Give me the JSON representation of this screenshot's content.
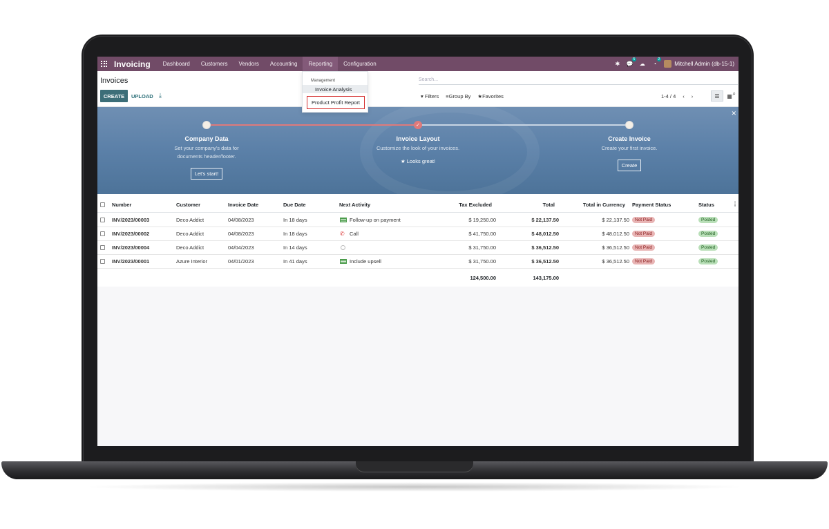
{
  "navbar": {
    "brand": "Invoicing",
    "menu": [
      "Dashboard",
      "Customers",
      "Vendors",
      "Accounting",
      "Reporting",
      "Configuration"
    ],
    "active_menu": "Reporting",
    "messages_badge": "5",
    "activities_badge": "2",
    "user": "Mitchell Admin (db-15-1)"
  },
  "control_panel": {
    "title": "Invoices",
    "create_label": "CREATE",
    "upload_label": "UPLOAD",
    "search_placeholder": "Search...",
    "filters_label": "Filters",
    "groupby_label": "Group By",
    "favorites_label": "Favorites",
    "pager": "1-4 / 4"
  },
  "dropdown": {
    "header": "Management",
    "items": [
      "Invoice Analysis",
      "Product Profit Report"
    ]
  },
  "banner": {
    "steps": [
      {
        "title": "Company Data",
        "desc1": "Set your company's data for",
        "desc2": "documents header/footer.",
        "button": "Let's start!"
      },
      {
        "title": "Invoice Layout",
        "desc1": "Customize the look of your invoices.",
        "status": "★ Looks great!"
      },
      {
        "title": "Create Invoice",
        "desc1": "Create your first invoice.",
        "button": "Create"
      }
    ]
  },
  "table": {
    "columns": [
      "Number",
      "Customer",
      "Invoice Date",
      "Due Date",
      "Next Activity",
      "Tax Excluded",
      "Total",
      "Total in Currency",
      "Payment Status",
      "Status"
    ],
    "rows": [
      {
        "number": "INV/2023/00003",
        "customer": "Deco Addict",
        "invoice_date": "04/08/2023",
        "due_date": "In 18 days",
        "activity": "Follow-up on payment",
        "activity_icon": "todo-icon",
        "tax_excluded": "$ 19,250.00",
        "total": "$ 22,137.50",
        "total_currency": "$ 22,137.50",
        "payment_status": "Not Paid",
        "status": "Posted"
      },
      {
        "number": "INV/2023/00002",
        "customer": "Deco Addict",
        "invoice_date": "04/08/2023",
        "due_date": "In 18 days",
        "activity": "Call",
        "activity_icon": "phone-icon",
        "tax_excluded": "$ 41,750.00",
        "total": "$ 48,012.50",
        "total_currency": "$ 48,012.50",
        "payment_status": "Not Paid",
        "status": "Posted"
      },
      {
        "number": "INV/2023/00004",
        "customer": "Deco Addict",
        "invoice_date": "04/04/2023",
        "due_date": "In 14 days",
        "activity": "",
        "activity_icon": "clock-icon",
        "tax_excluded": "$ 31,750.00",
        "total": "$ 36,512.50",
        "total_currency": "$ 36,512.50",
        "payment_status": "Not Paid",
        "status": "Posted"
      },
      {
        "number": "INV/2023/00001",
        "customer": "Azure Interior",
        "invoice_date": "04/01/2023",
        "due_date": "In 41 days",
        "activity": "Include upsell",
        "activity_icon": "todo-icon",
        "tax_excluded": "$ 31,750.00",
        "total": "$ 36,512.50",
        "total_currency": "$ 36,512.50",
        "payment_status": "Not Paid",
        "status": "Posted"
      }
    ],
    "totals": {
      "tax_excluded": "124,500.00",
      "total": "143,175.00"
    }
  },
  "colors": {
    "navbar": "#714b67",
    "primary": "#3c6e78",
    "highlight": "#d42c2c"
  }
}
